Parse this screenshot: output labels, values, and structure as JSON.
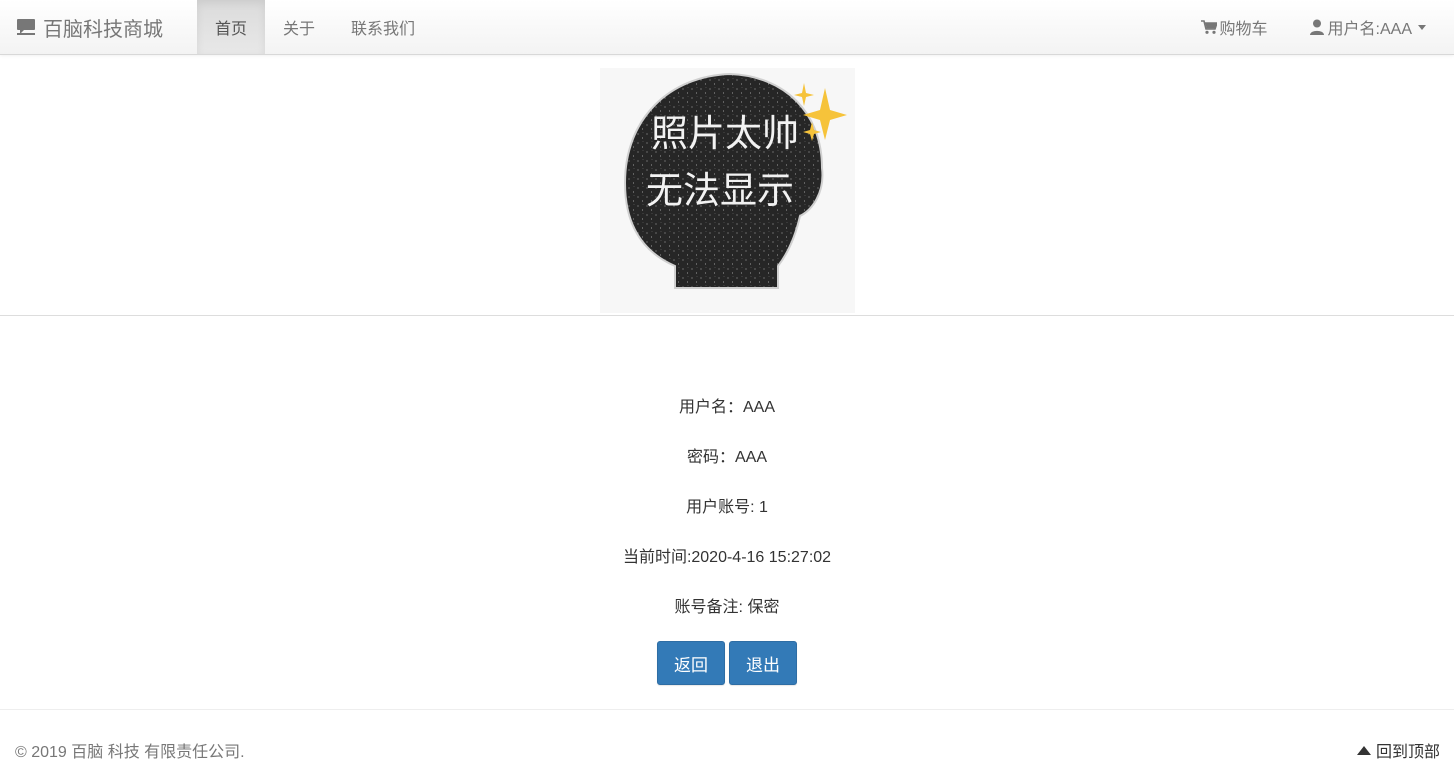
{
  "navbar": {
    "brand": "百脑科技商城",
    "brand_icon": "comment-icon",
    "links": [
      {
        "label": "首页",
        "active": true
      },
      {
        "label": "关于",
        "active": false
      },
      {
        "label": "联系我们",
        "active": false
      }
    ],
    "cart_label": "购物车",
    "cart_icon": "shopping-cart-icon",
    "user_label": "用户名:AAA",
    "user_icon": "user-icon"
  },
  "avatar": {
    "text_line1": "照片太帅",
    "text_line2": "无法显示"
  },
  "profile": {
    "username_line": "用户名：AAA",
    "password_line": "密码：AAA",
    "account_line": "用户账号: 1",
    "time_line": "当前时间:2020-4-16 15:27:02",
    "remark_line": "账号备注: 保密"
  },
  "buttons": {
    "back_label": "返回",
    "logout_label": "退出"
  },
  "footer": {
    "copyright": "© 2019 百脑 科技 有限责任公司.",
    "back_to_top": "回到顶部"
  },
  "colors": {
    "primary": "#337ab7",
    "text": "#333333",
    "muted": "#777777"
  }
}
